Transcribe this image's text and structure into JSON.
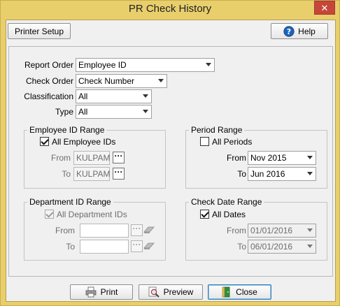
{
  "window": {
    "title": "PR Check History",
    "close_glyph": "✕"
  },
  "toolbar": {
    "printer_setup": "Printer Setup",
    "help": "Help"
  },
  "form": {
    "report_order": {
      "label": "Report Order",
      "value": "Employee ID"
    },
    "check_order": {
      "label": "Check Order",
      "value": "Check Number"
    },
    "classification": {
      "label": "Classification",
      "value": "All"
    },
    "type": {
      "label": "Type",
      "value": "All"
    }
  },
  "employee_range": {
    "title": "Employee ID Range",
    "all_label": "All Employee IDs",
    "from_label": "From",
    "from_value": "KULPAM",
    "to_label": "To",
    "to_value": "KULPAM",
    "dots": "···"
  },
  "period_range": {
    "title": "Period Range",
    "all_label": "All Periods",
    "from_label": "From",
    "from_value": "Nov 2015",
    "to_label": "To",
    "to_value": "Jun 2016"
  },
  "department_range": {
    "title": "Department ID Range",
    "all_label": "All Department IDs",
    "from_label": "From",
    "to_label": "To",
    "dots": "···"
  },
  "check_date_range": {
    "title": "Check Date Range",
    "all_label": "All Dates",
    "from_label": "From",
    "from_value": "01/01/2016",
    "to_label": "To",
    "to_value": "06/01/2016"
  },
  "footer": {
    "print": "Print",
    "preview": "Preview",
    "close": "Close"
  }
}
